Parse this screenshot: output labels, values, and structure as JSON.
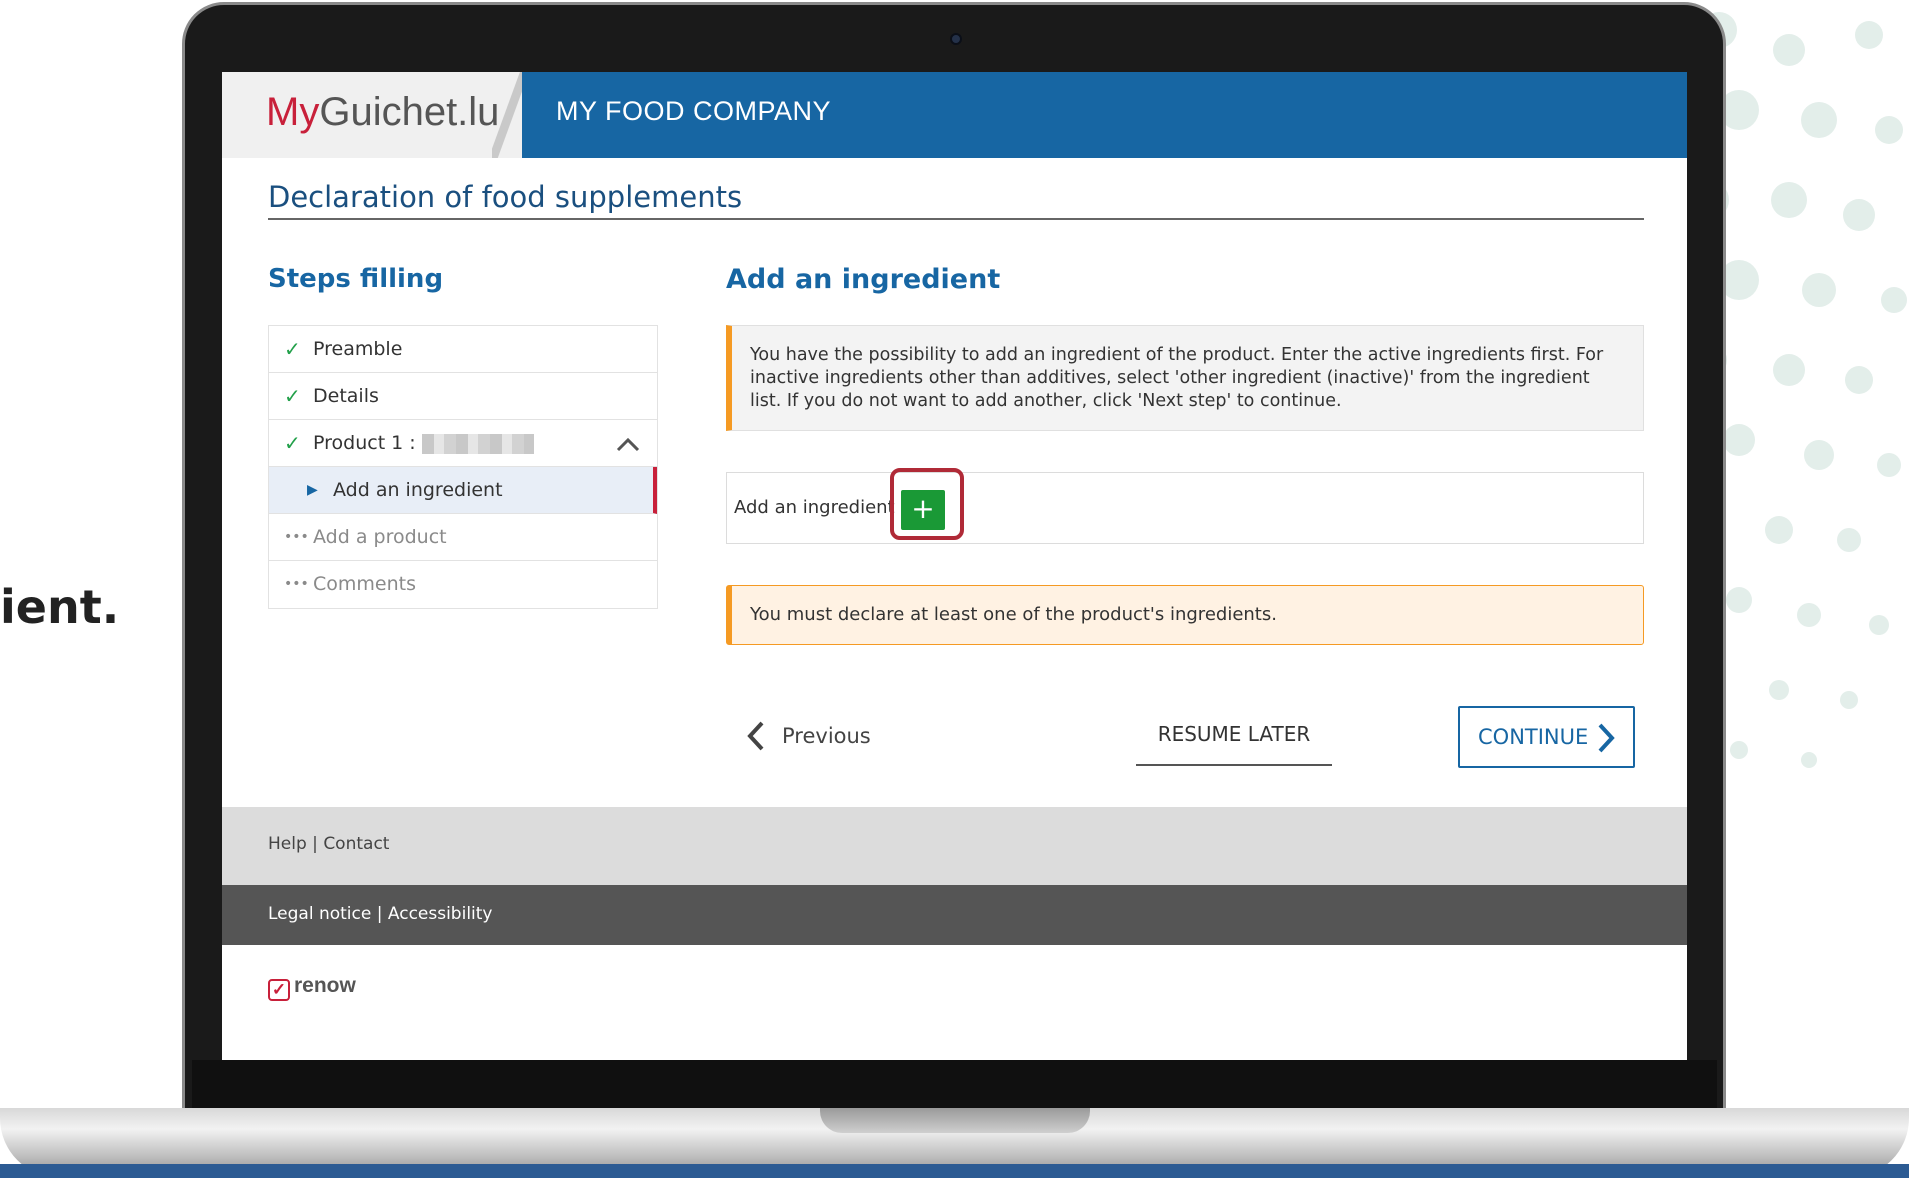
{
  "side_text": "ient.",
  "app": {
    "logo_prefix": "My",
    "logo_rest": "Guichet.lu",
    "company": "MY FOOD COMPANY"
  },
  "page": {
    "title": "Declaration of food supplements"
  },
  "steps": {
    "title": "Steps filling",
    "items": [
      {
        "label": "Preamble",
        "status": "done"
      },
      {
        "label": "Details",
        "status": "done"
      },
      {
        "label": "Product 1 :",
        "status": "done"
      },
      {
        "label": "Add an ingredient",
        "status": "active"
      },
      {
        "label": "Add a product",
        "status": "pending"
      },
      {
        "label": "Comments",
        "status": "pending"
      }
    ]
  },
  "main": {
    "section_title": "Add an ingredient",
    "info_text": "You have the possibility to add an ingredient of the product. Enter the active ingredients first. For inactive ingredients other than additives, select 'other ingredient (inactive)' from the ingredient list. If you do not want to add another, click 'Next step' to continue.",
    "add_label": "Add an ingredient",
    "add_button": "+",
    "warning_text": "You must declare at least one of the product's ingredients."
  },
  "nav": {
    "previous": "Previous",
    "resume_later": "RESUME LATER",
    "continue": "CONTINUE"
  },
  "footer": {
    "help": "Help",
    "contact": "Contact",
    "legal": "Legal notice",
    "accessibility": "Accessibility",
    "separator": "|",
    "brand": "renow"
  },
  "colors": {
    "header_blue": "#1766a3",
    "brand_red": "#c8203a",
    "success_green": "#1a9936",
    "warning_orange": "#f59a23"
  },
  "icons": [
    "check-icon",
    "chevron-up-icon",
    "caret-right-icon",
    "ellipsis-icon",
    "plus-icon",
    "chevron-left-icon",
    "chevron-right-icon",
    "renow-check-icon"
  ]
}
